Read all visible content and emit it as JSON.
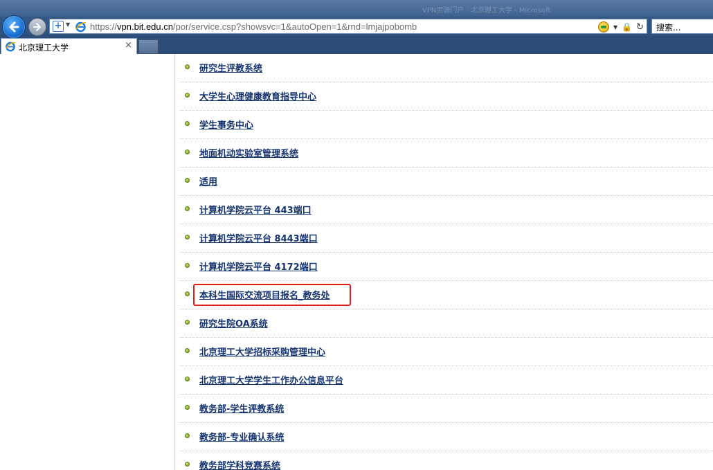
{
  "browser": {
    "ghost_title": "VPN资源门户 · 北京理工大学 - Microsoft",
    "address": {
      "scheme": "https://",
      "host": "vpn.bit.edu.cn",
      "path": "/por/service.csp?showsvc=1&autoOpen=1&rnd=lmjajpobomb"
    },
    "search_placeholder": "搜索...",
    "tab_title": "北京理工大学",
    "tab_close": "×"
  },
  "services": [
    {
      "label": "研究生评教系统"
    },
    {
      "label": "大学生心理健康教育指导中心"
    },
    {
      "label": "学生事务中心"
    },
    {
      "label": "地面机动实验室管理系统"
    },
    {
      "label": "适用"
    },
    {
      "label": "计算机学院云平台 443端口"
    },
    {
      "label": "计算机学院云平台 8443端口"
    },
    {
      "label": "计算机学院云平台 4172端口"
    },
    {
      "label": "本科生国际交流项目报名_教务处"
    },
    {
      "label": "研究生院OA系统"
    },
    {
      "label": "北京理工大学招标采购管理中心"
    },
    {
      "label": "北京理工大学学生工作办公信息平台"
    },
    {
      "label": "教务部-学生评教系统"
    },
    {
      "label": "教务部-专业确认系统"
    },
    {
      "label": "教务部学科竞赛系统"
    }
  ],
  "highlighted_service": "本科生国际交流项目报名_教务处",
  "colors": {
    "link": "#163470",
    "bullet": "#7aa520",
    "highlight_border": "#e21b1b",
    "chrome": "#2e527e"
  }
}
